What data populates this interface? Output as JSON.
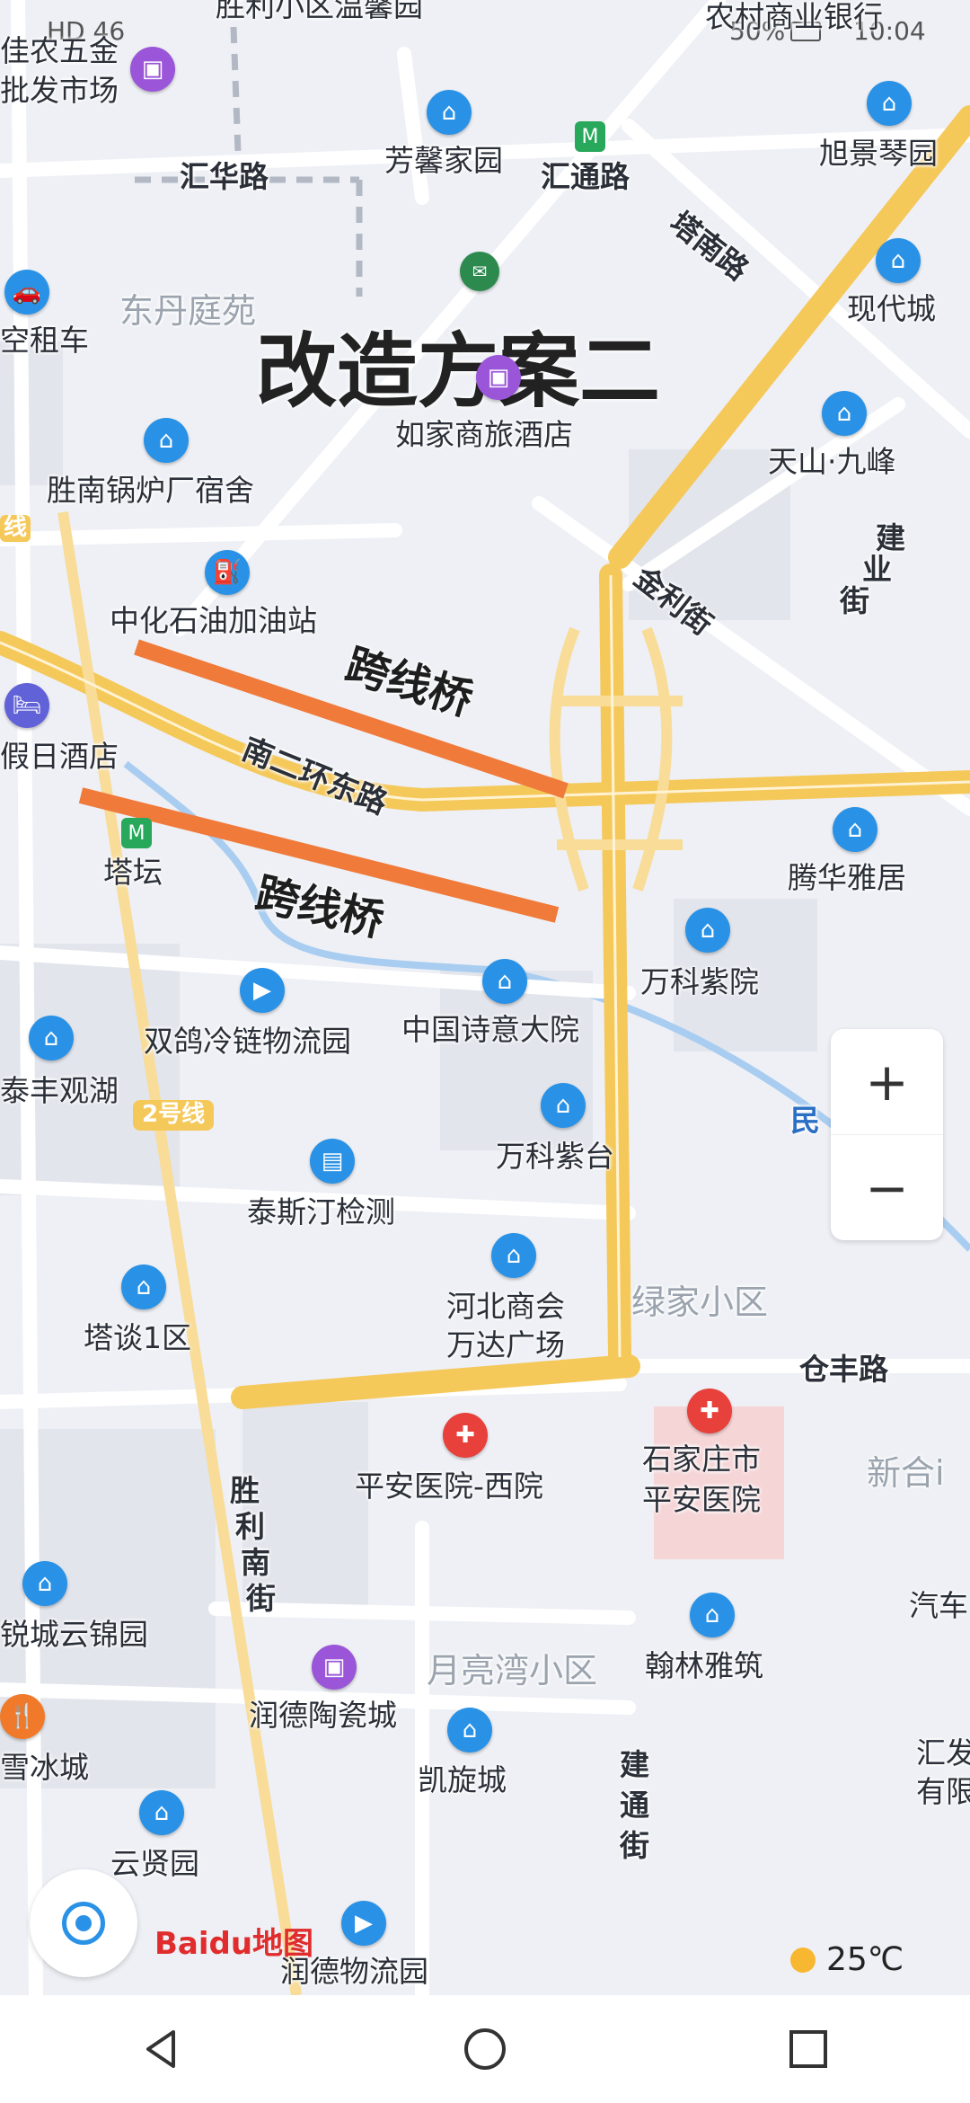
{
  "status_bar": {
    "left": "HD 46",
    "battery": "50%",
    "time": "10:04"
  },
  "annotation": {
    "title": "改造方案二",
    "bridge_1": "跨线桥",
    "bridge_2": "跨线桥",
    "color": "#f07a3a"
  },
  "roads": {
    "huihua": "汇华路",
    "huitong": "汇通路",
    "tanan": "塔南路",
    "jinli": "金利街",
    "jianye_1": "建",
    "jianye_2": "业",
    "jianye_3": "街",
    "nanerhuan": "南二环东路",
    "cangfeng": "仓丰路",
    "shengli_1": "胜",
    "shengli_2": "利",
    "shengli_3": "南",
    "shengli_4": "街",
    "jiantong_1": "建",
    "jiantong_2": "通",
    "jiantong_3": "街",
    "min": "民",
    "line": "线",
    "line2": "2号线"
  },
  "areas": {
    "dongdan": "东丹庭苑",
    "lvjia": "绿家小区",
    "yueliangwan": "月亮湾小区",
    "xinhe": "新合ⅰ"
  },
  "pois": {
    "fangxin": "芳馨家园",
    "xujing": "旭景琴园",
    "xiandai": "现代城",
    "tianshan": "天山·九峰",
    "rujia": "如家商旅酒店",
    "shengnan": "胜南锅炉厂宿舍",
    "zhonghua": "中化石油加油站",
    "jiari": "假日酒店",
    "tatan": "塔坛",
    "tenghua": "腾华雅居",
    "wanke_yuan": "万科紫院",
    "shuangge": "双鸽冷链物流园",
    "shiyi": "中国诗意大院",
    "taifeng": "泰丰观湖",
    "wanke_tai": "万科紫台",
    "taisiting": "泰斯汀检测",
    "hebei_1": "河北商会",
    "hebei_2": "万达广场",
    "tatan1": "塔谈1区",
    "pingan_west": "平安医院-西院",
    "sjz_1": "石家庄市",
    "sjz_2": "平安医院",
    "yunjin": "锐城云锦园",
    "hanlin": "翰林雅筑",
    "runde_tc": "润德陶瓷城",
    "kaixuan": "凯旋城",
    "xuebing": "雪冰城",
    "yunxian": "云贤园",
    "runde_wl": "润德物流园",
    "kongzu": "空租车",
    "nongye_top": "农村商业银行",
    "pifa_1": "佳农五金",
    "pifa_2": "批发市场",
    "shengli_xq": "胜利小区温馨园",
    "qiche": "汽车",
    "huifa_1": "汇发",
    "huifa_2": "有限"
  },
  "zoom": {
    "in": "+",
    "out": "−"
  },
  "logo": "Baidu地图",
  "weather": {
    "temp": "25℃"
  }
}
